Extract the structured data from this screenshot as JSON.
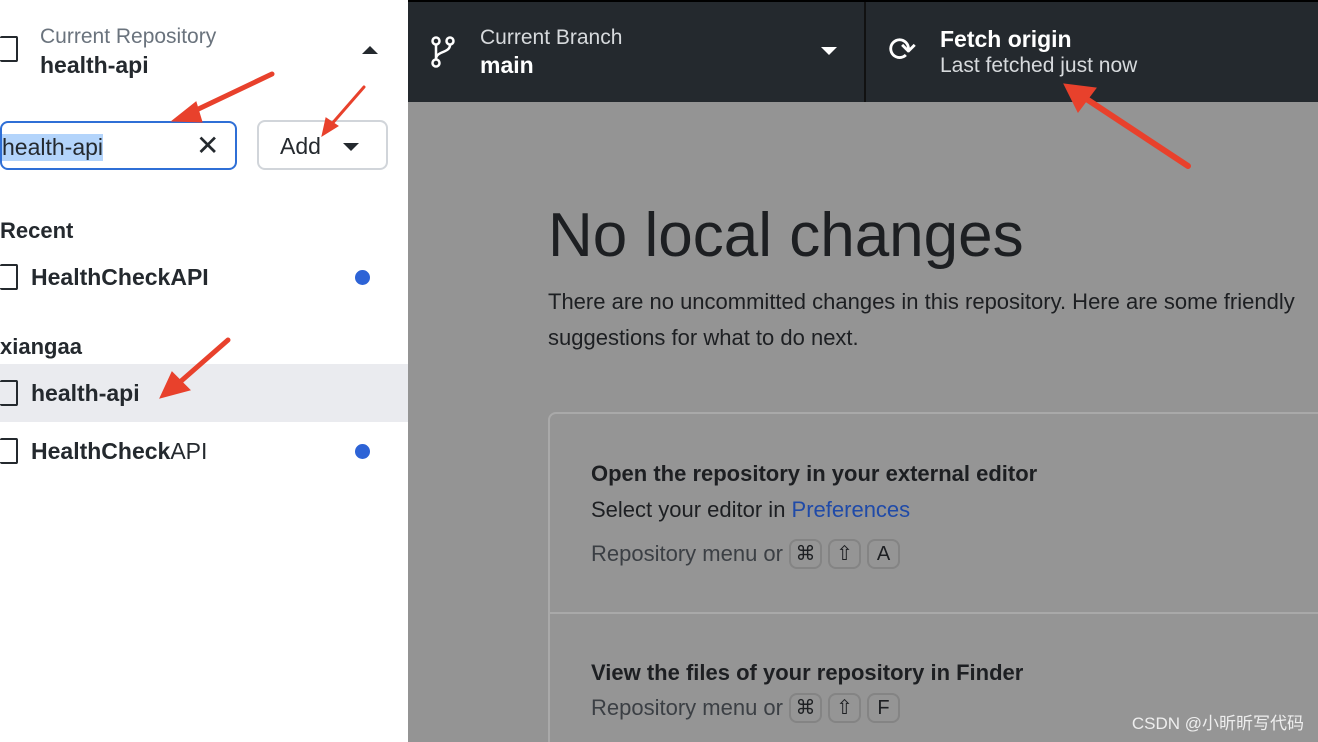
{
  "sidebar": {
    "header_label": "Current Repository",
    "header_value": "health-api",
    "search_value": "health-api",
    "add_label": "Add",
    "groups": [
      {
        "name": "Recent",
        "items": [
          {
            "name_bold": "HealthCheck",
            "name_reg": "",
            "name_bold2": "API",
            "changes": true
          }
        ]
      },
      {
        "name": "xiangaa",
        "items": [
          {
            "name": "health-api",
            "selected": true
          },
          {
            "name_bold": "HealthCheck",
            "name_bold2": "API",
            "changes": true
          }
        ]
      }
    ]
  },
  "topbar": {
    "branch_label": "Current Branch",
    "branch_value": "main",
    "fetch_label": "Fetch origin",
    "fetch_sub": "Last fetched just now"
  },
  "main": {
    "title": "No local changes",
    "desc_line1": "There are no uncommitted changes in this repository. Here are some friendly suggestions",
    "desc_line2": "for what to do next.",
    "cards": [
      {
        "title": "Open the repository in your external editor",
        "sub_prefix": "Select your editor in ",
        "sub_link": "Preferences",
        "hint": "Repository menu or",
        "keys": [
          "⌘",
          "⇧",
          "A"
        ]
      },
      {
        "title": "View the files of your repository in Finder",
        "hint": "Repository menu or",
        "keys": [
          "⌘",
          "⇧",
          "F"
        ]
      }
    ]
  },
  "watermark": "CSDN @小昕昕写代码",
  "colors": {
    "accent": "#2f6fd6",
    "annotation": "#e8412c",
    "topbar": "#24292e"
  }
}
